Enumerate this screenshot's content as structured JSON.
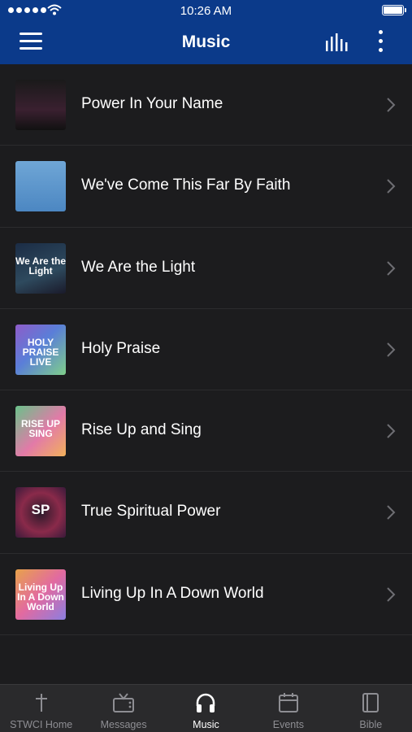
{
  "status_bar": {
    "time": "10:26 AM"
  },
  "header": {
    "title": "Music"
  },
  "icons": {
    "menu": "hamburger-menu-icon",
    "equalizer": "bars-icon",
    "more": "vertical-dots-icon",
    "chevron": "chevron-right-icon"
  },
  "albums": [
    {
      "title": "Power In Your Name",
      "art_text": ""
    },
    {
      "title": "We've Come This Far By Faith",
      "art_text": ""
    },
    {
      "title": "We Are the Light",
      "art_text": "We Are the Light"
    },
    {
      "title": "Holy Praise",
      "art_text": "HOLY PRAISE LIVE"
    },
    {
      "title": "Rise Up and Sing",
      "art_text": "RISE UP SING"
    },
    {
      "title": "True Spiritual Power",
      "art_text": "SP"
    },
    {
      "title": "Living Up In A Down World",
      "art_text": "Living Up In A Down World"
    }
  ],
  "tabs": [
    {
      "label": "STWCI Home",
      "icon": "cross-icon",
      "active": false
    },
    {
      "label": "Messages",
      "icon": "tv-icon",
      "active": false
    },
    {
      "label": "Music",
      "icon": "headphones-icon",
      "active": true
    },
    {
      "label": "Events",
      "icon": "calendar-icon",
      "active": false
    },
    {
      "label": "Bible",
      "icon": "book-icon",
      "active": false
    }
  ],
  "colors": {
    "header_bg": "#0b3a8a",
    "list_bg": "#1c1c1e",
    "tabbar_bg": "#2a2a2c",
    "inactive_tab": "#8e8e93"
  }
}
